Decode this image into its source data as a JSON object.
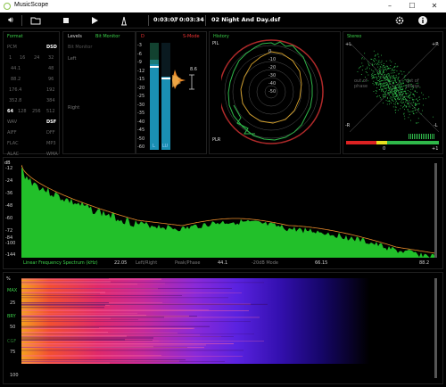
{
  "window": {
    "title": "MusicScope",
    "minimize": "–",
    "maximize": "☐",
    "close": "✕"
  },
  "toolbar": {
    "position": "0:03:07",
    "separator": "/",
    "duration": "0:03:34",
    "track": "02 Night And Day.dsf"
  },
  "format": {
    "title": "Format",
    "pcm_label": "PCM",
    "dsd_label": "DSD",
    "pcm_bits": [
      "16",
      "24",
      "32"
    ],
    "pcm_rates_left": [
      "44.1",
      "88.2",
      "176.4",
      "352.8"
    ],
    "dsd_rates_right": [
      "48",
      "96",
      "192",
      "384"
    ],
    "dsd_multiples": [
      "64",
      "128",
      "256",
      "512"
    ],
    "dsd_selected": "64",
    "formats_left": [
      "WAV",
      "AIFF",
      "FLAC",
      "ALAC"
    ],
    "formats_right": [
      "DSF",
      "DFF",
      "MP3",
      "WMA"
    ],
    "format_selected": "DSF"
  },
  "levels": {
    "title": "Levels",
    "bit_monitor": "Bit Monitor",
    "bit_monitor_sub": "Bit Monitor",
    "left": "Left",
    "right": "Right"
  },
  "meter": {
    "title_d": "D",
    "s_mode": "S-Mode",
    "scale": [
      "-3",
      "-6",
      "-9",
      "-12",
      "-15",
      "-20",
      "-25",
      "-30",
      "-35",
      "-40",
      "-45",
      "-50",
      "-60"
    ],
    "peak_value": "8.6",
    "l_label": "L",
    "r_label": "LU",
    "l_level": 0.84,
    "r_level": 0.68
  },
  "history": {
    "title": "History",
    "pil": "PIL",
    "plr": "PLR",
    "rings": [
      "0",
      "-10",
      "-20",
      "-30",
      "-40",
      "-50"
    ]
  },
  "stereo": {
    "title": "Stereo",
    "plus_l": "+L",
    "plus_r": "+R",
    "minus_l": "-R",
    "minus_r": "-L",
    "out_of_phase_left": "out of phase",
    "out_of_phase_right": "out of phase",
    "corr_mid": "0",
    "corr_right": "+1"
  },
  "spectrum": {
    "db_label": "dB",
    "y_ticks": [
      "-12",
      "-24",
      "-36",
      "-48",
      "-60",
      "-72",
      "-84",
      "-100",
      "-144"
    ],
    "title": "Linear Frequency Spectrum (kHz)",
    "modes": [
      "Left/Right",
      "Peak/Phase",
      "-20dB Mode"
    ],
    "x_ticks": [
      "22.05",
      "44.1",
      "66.15",
      "88.2"
    ]
  },
  "spectrogram": {
    "pct": "%",
    "y_ticks": [
      "25",
      "50",
      "75",
      "100"
    ],
    "side_labels": [
      "MAX",
      "BRY",
      "CGF"
    ]
  },
  "colors": {
    "accent_green": "#3cd14a",
    "meter_blue": "#1a8fb3",
    "orange": "#e88a2a",
    "red": "#e33333"
  }
}
